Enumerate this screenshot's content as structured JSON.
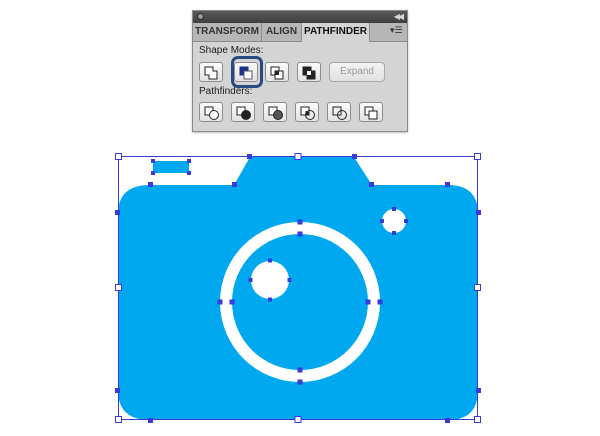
{
  "panel": {
    "tabs": [
      {
        "label": "TRANSFORM",
        "active": false
      },
      {
        "label": "ALIGN",
        "active": false
      },
      {
        "label": "PATHFINDER",
        "active": true
      }
    ],
    "shape_modes_label": "Shape Modes:",
    "shape_mode_buttons": [
      "unite-icon",
      "minus-front-icon",
      "intersect-icon",
      "exclude-icon"
    ],
    "selected_shape_mode": "minus-front-icon",
    "expand_label": "Expand",
    "pathfinders_label": "Pathfinders:",
    "pathfinder_buttons": [
      "divide-icon",
      "trim-icon",
      "merge-icon",
      "crop-icon",
      "outline-icon",
      "minus-back-icon"
    ]
  },
  "canvas": {
    "shape_fill": "#00a8f0",
    "selection_color": "#3a3adc",
    "background": "#ffffff"
  }
}
